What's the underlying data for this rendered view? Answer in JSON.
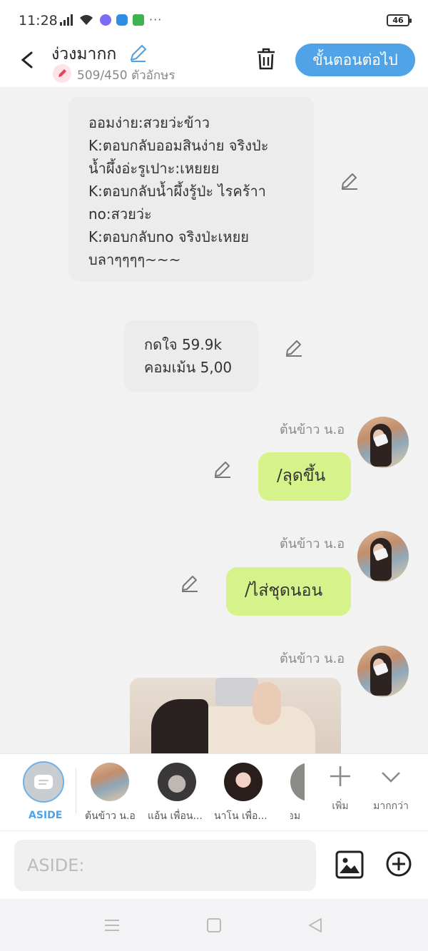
{
  "status_bar": {
    "time": "11:28",
    "icons": [
      "signal-icon",
      "wifi-icon",
      "messenger-icon",
      "app-icon",
      "android-icon"
    ],
    "more": "···",
    "battery": "46"
  },
  "header": {
    "title": "ง่วงมากก",
    "char_count": "509/450",
    "char_unit": "ตัวอักษร",
    "next_label": "ขั้นตอนต่อไป"
  },
  "messages": {
    "aside1": {
      "lines": [
        "ออมง่าย:สวยว่ะข้าว",
        "K:ตอบกลับออมสินง่าย จริงป่ะ",
        "น้ำผึ้งอ่ะรูเปาะ:เหยยย",
        "K:ตอบกลับน้ำผึ้งรู้ป่ะ ไรคร้าา",
        "no:สวยว่ะ",
        "K:ตอบกลับno จริงป่ะเหยย",
        "บลาๆๆๆๆ~~~"
      ]
    },
    "aside2": {
      "lines": [
        "กดใจ 59.9k",
        "คอมเม้น 5,00"
      ]
    },
    "msg1": {
      "sender": "ต้นข้าว น.อ",
      "text": "/ลุดขึ้น"
    },
    "msg2": {
      "sender": "ต้นข้าว น.อ",
      "text": "/ไส่ชุดนอน"
    },
    "msg3": {
      "sender": "ต้นข้าว น.อ"
    }
  },
  "character_bar": {
    "aside_label": "ASIDE",
    "characters": [
      {
        "name": "ต้นข้าว น.อ"
      },
      {
        "name": "แอ้น เพื่อน..."
      },
      {
        "name": "นาโน เพื่อ..."
      },
      {
        "name": "ออม"
      }
    ],
    "add_label": "เพิ่ม",
    "more_label": "มากกว่า"
  },
  "input_bar": {
    "placeholder": "ASIDE:"
  },
  "colors": {
    "accent": "#4fa3e6",
    "bubble_green": "#d6f28a",
    "bubble_gray": "#ececec"
  }
}
